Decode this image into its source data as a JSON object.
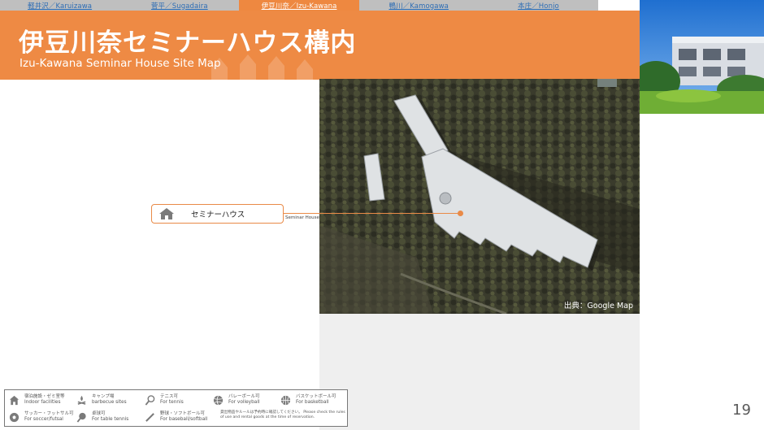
{
  "nav": {
    "items": [
      {
        "label": "軽井沢／Karuizawa",
        "active": false
      },
      {
        "label": "菅平／Sugadaira",
        "active": false
      },
      {
        "label": "伊豆川奈／Izu-Kawana",
        "active": true
      },
      {
        "label": "鴨川／Kamogawa",
        "active": false
      },
      {
        "label": "本庄／Honjo",
        "active": false
      }
    ]
  },
  "header": {
    "title": "伊豆川奈セミナーハウス構内",
    "subtitle": "Izu-Kawana Seminar House Site Map"
  },
  "map": {
    "credit": "出典：Google Map"
  },
  "marker": {
    "label": "セミナーハウス",
    "caption": "Seminar House"
  },
  "legend": {
    "items": [
      {
        "icon": "home-icon",
        "jp": "宿泊施設・ゼミ室等",
        "en": "Indoor facilities"
      },
      {
        "icon": "campfire-icon",
        "jp": "キャンプ場",
        "en": "barbecue sites"
      },
      {
        "icon": "tennis-icon",
        "jp": "テニス可",
        "en": "For tennis"
      },
      {
        "icon": "volleyball-icon",
        "jp": "バレーボール可",
        "en": "For volleyball"
      },
      {
        "icon": "basketball-icon",
        "jp": "バスケットボール可",
        "en": "For basketball"
      },
      {
        "icon": "soccer-icon",
        "jp": "サッカー・フットサル可",
        "en": "For soccer/futsal"
      },
      {
        "icon": "table-tennis-icon",
        "jp": "卓球可",
        "en": "For table tennis"
      },
      {
        "icon": "baseball-icon",
        "jp": "野球・ソフトボール可",
        "en": "For baseball/softball"
      }
    ],
    "note": "貸出物品やルールは予約時に確認してください。 Please check the rules of use and rental goods at the time of reservation."
  },
  "page_number": "19",
  "colors": {
    "accent": "#ee8a44",
    "nav_bg": "#bfbfbf",
    "link": "#2e6db4"
  }
}
